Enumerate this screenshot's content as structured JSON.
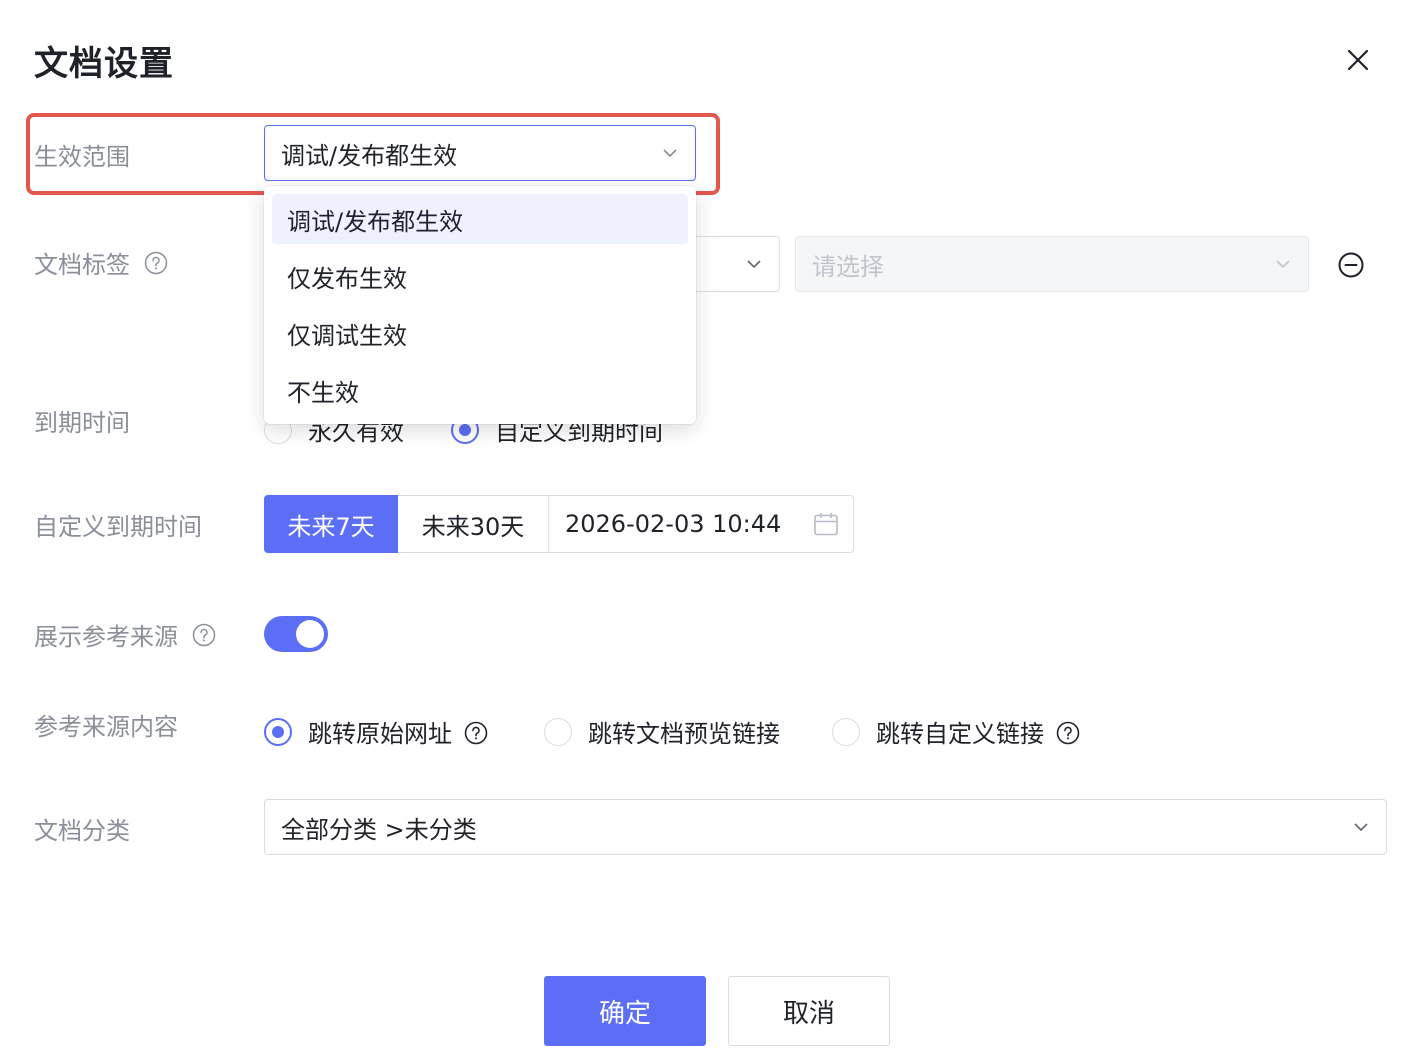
{
  "dialog": {
    "title": "文档设置"
  },
  "fields": {
    "scope": {
      "label": "生效范围",
      "value": "调试/发布都生效",
      "options": [
        "调试/发布都生效",
        "仅发布生效",
        "仅调试生效",
        "不生效"
      ]
    },
    "tags": {
      "label": "文档标签",
      "placeholder": "请选择"
    },
    "expiry": {
      "label": "到期时间",
      "options": [
        "永久有效",
        "自定义到期时间"
      ]
    },
    "custom_expiry": {
      "label": "自定义到期时间",
      "preset_7": "未来7天",
      "preset_30": "未来30天",
      "datetime": "2026-02-03 10:44"
    },
    "show_source": {
      "label": "展示参考来源",
      "enabled": true
    },
    "source_content": {
      "label": "参考来源内容",
      "options": [
        "跳转原始网址",
        "跳转文档预览链接",
        "跳转自定义链接"
      ],
      "selected": "跳转原始网址"
    },
    "category": {
      "label": "文档分类",
      "value": "全部分类 >未分类"
    }
  },
  "footer": {
    "confirm": "确定",
    "cancel": "取消"
  },
  "colors": {
    "accent": "#5b6ef5",
    "highlight": "#e4574b",
    "label": "#8a8f99"
  }
}
